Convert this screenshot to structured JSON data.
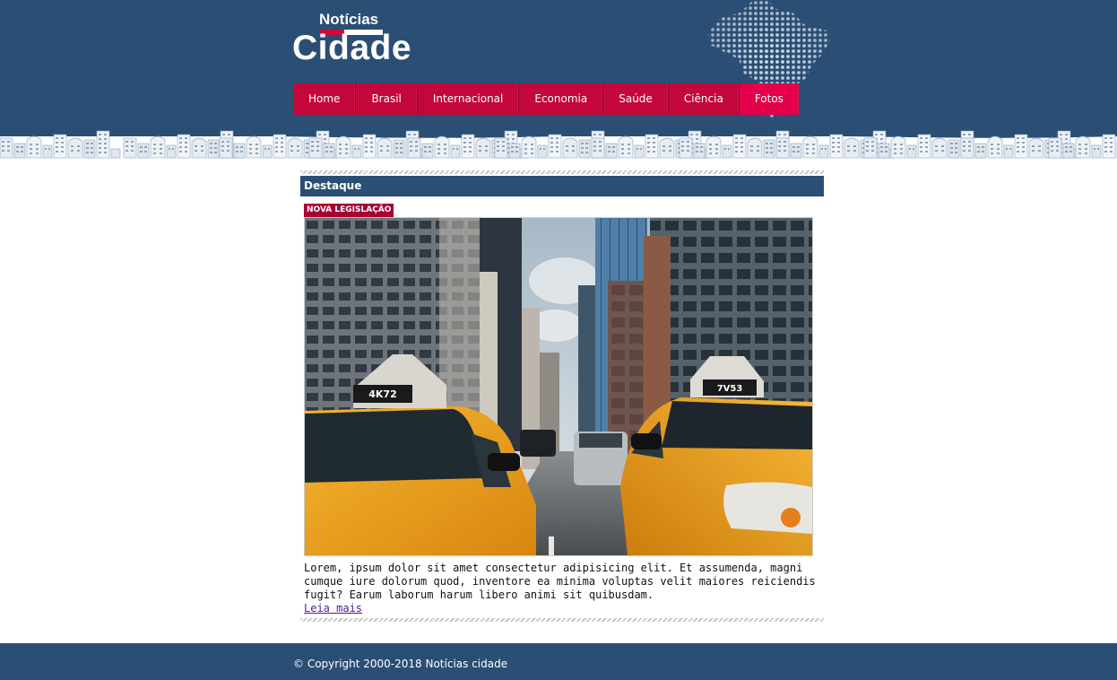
{
  "logo": {
    "top": "Notícias",
    "bottom": "Cidade"
  },
  "nav": [
    "Home",
    "Brasil",
    "Internacional",
    "Economia",
    "Saúde",
    "Ciência",
    "Fotos"
  ],
  "active_nav": "Fotos",
  "section": {
    "title": "Destaque"
  },
  "article": {
    "tag": "NOVA LEGISLAÇÃO",
    "text": "Lorem, ipsum dolor sit amet consectetur adipisicing elit. Et assumenda, magni cumque iure dolorum quod, inventore ea minima voluptas velit maiores reiciendis fugit? Earum laborum harum libero animi sit quibusdam.",
    "link": "Leia mais",
    "plate_left": "4K72",
    "plate_right": "7V53"
  },
  "footer": "© Copyright 2000-2018 Notícias cidade",
  "colors": {
    "header": "#2b4e74",
    "nav": "#c3073a",
    "nav_active": "#e4004a",
    "tag": "#a80031",
    "taxi": "#f2a91e"
  }
}
